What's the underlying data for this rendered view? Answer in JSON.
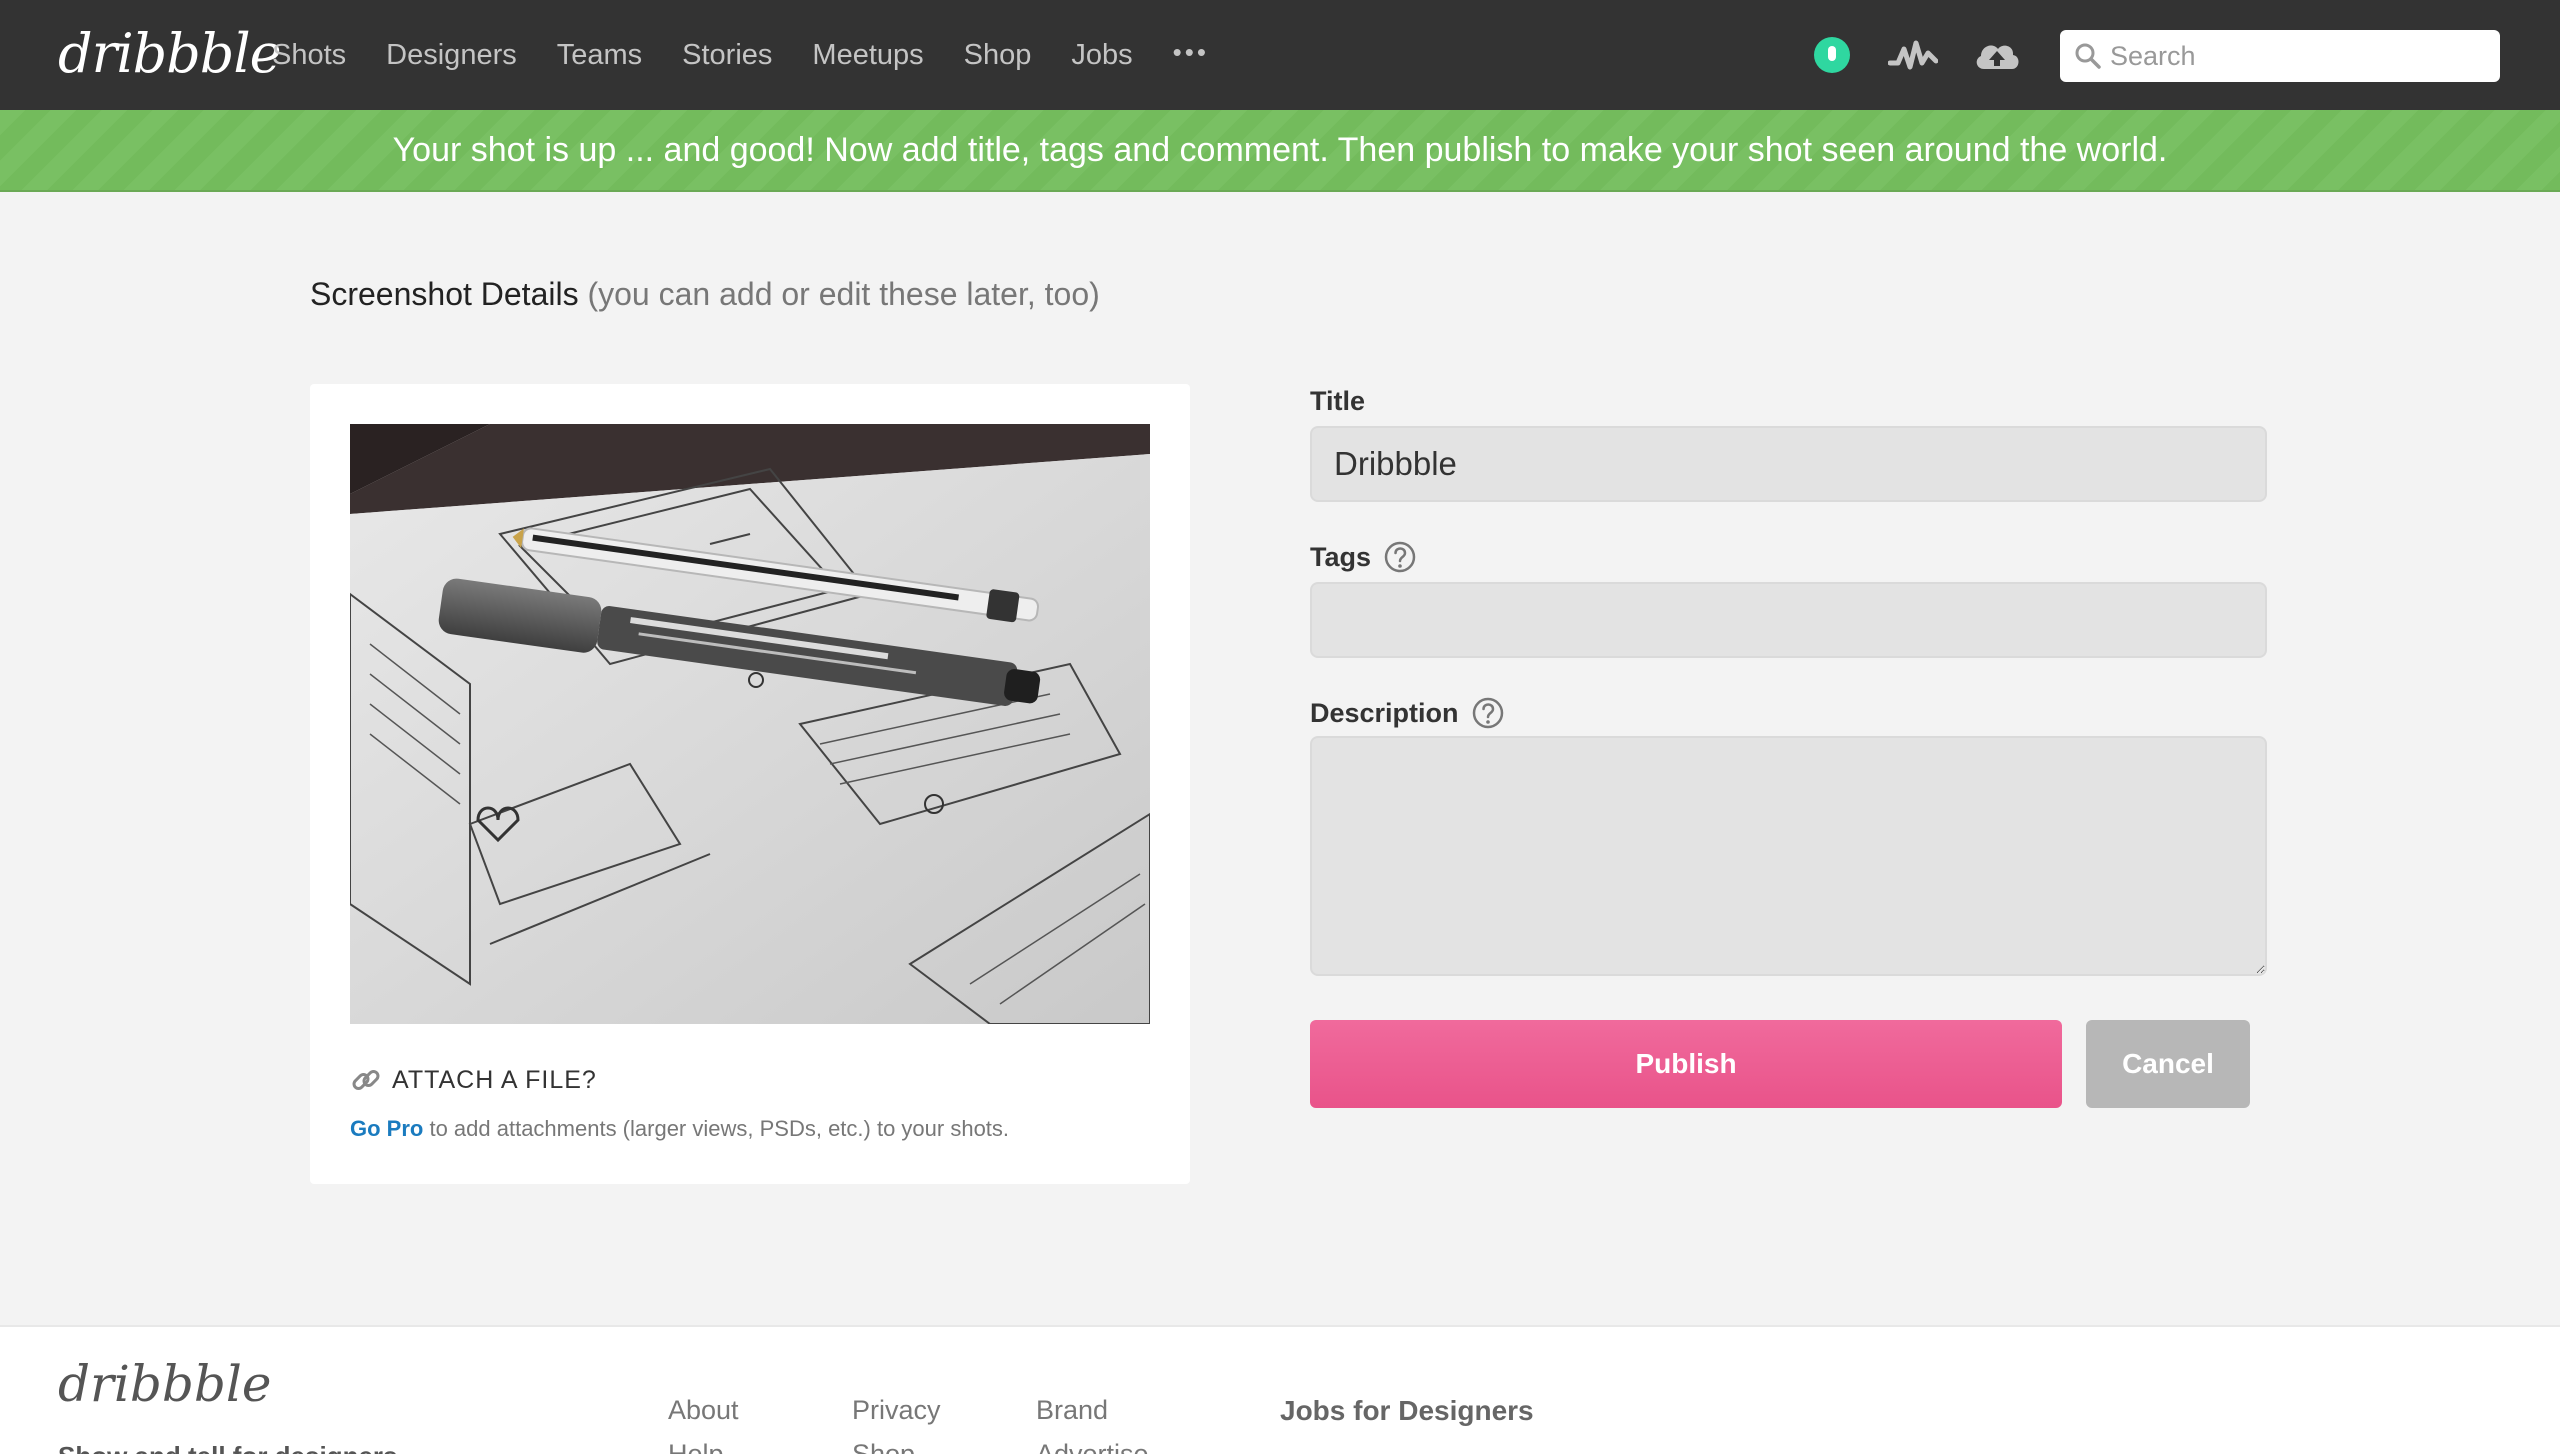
{
  "header": {
    "logo": "dribbble",
    "nav": [
      "Shots",
      "Designers",
      "Teams",
      "Stories",
      "Meetups",
      "Shop",
      "Jobs"
    ],
    "more_icon": "more-dots-icon",
    "more_glyph": "•••",
    "icons": [
      "status-dot-icon",
      "activity-icon",
      "upload-cloud-icon"
    ],
    "search": {
      "placeholder": "Search",
      "value": ""
    }
  },
  "banner": {
    "message": "Your shot is up ... and good! Now add title, tags and comment. Then publish to make your shot seen around the world."
  },
  "page": {
    "heading": "Screenshot Details",
    "subheading": "(you can add or edit these later, too)"
  },
  "upload_card": {
    "attach_label": "ATTACH A FILE?",
    "go_pro_link": "Go Pro",
    "go_pro_text": " to add attachments (larger views, PSDs, etc.) to your shots."
  },
  "form": {
    "title_label": "Title",
    "title_value": "Dribbble",
    "tags_label": "Tags",
    "tags_value": "",
    "description_label": "Description",
    "description_value": "",
    "publish_label": "Publish",
    "cancel_label": "Cancel"
  },
  "footer": {
    "logo": "dribbble",
    "tagline": "Show and tell for designers",
    "col1": [
      "About",
      "Help"
    ],
    "col2": [
      "Privacy",
      "Shop"
    ],
    "col3": [
      "Brand",
      "Advertise"
    ],
    "jobs_heading": "Jobs for Designers"
  },
  "colors": {
    "nav_bg": "#333333",
    "banner_green": "#79c063",
    "publish_pink": "#ea4c89",
    "cancel_gray": "#b7b7b7",
    "link_blue": "#1a7bbf",
    "status_green": "#2fd7a0"
  }
}
